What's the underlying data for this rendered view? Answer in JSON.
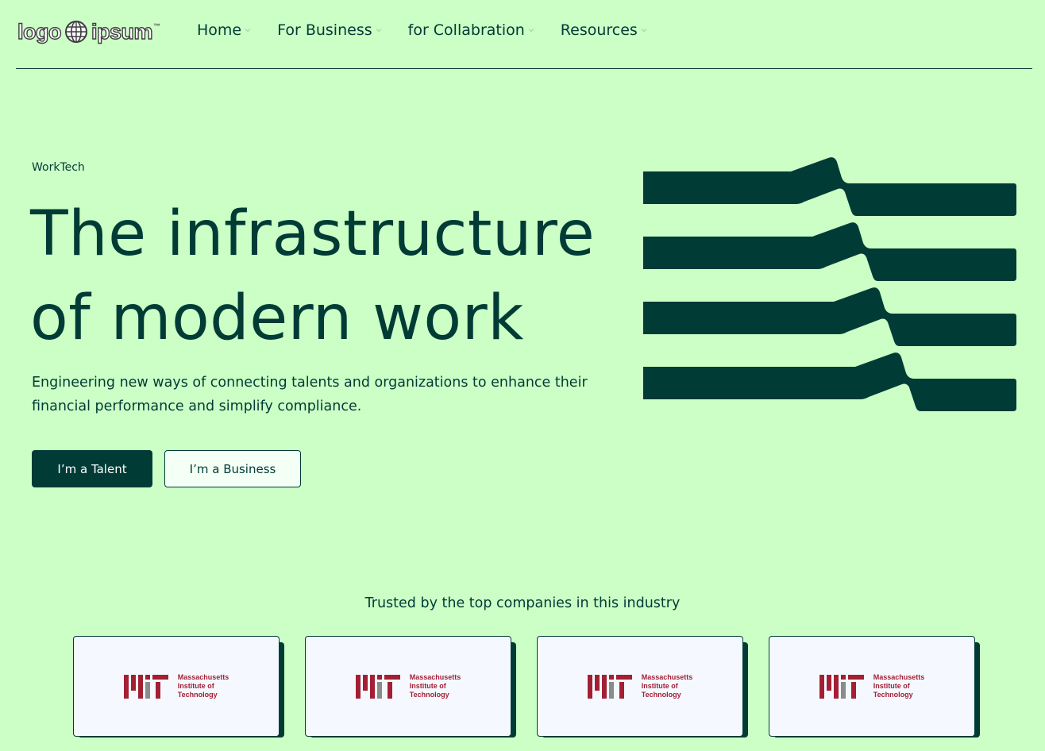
{
  "brand": {
    "logo_left": "logo",
    "logo_right": "ipsum",
    "tm": "™"
  },
  "nav": {
    "items": [
      {
        "label": "Home"
      },
      {
        "label": "For Business"
      },
      {
        "label": "for Collabration"
      },
      {
        "label": "Resources"
      }
    ]
  },
  "hero": {
    "eyebrow": "WorkTech",
    "headline_line1": "The infrastructure",
    "headline_line2": "of modern work",
    "subtext": "Engineering new ways of connecting talents and organizations to enhance their financial performance and simplify compliance.",
    "primary_button": "I’m a Talent",
    "secondary_button": "I’m a Business"
  },
  "trusted": {
    "heading": "Trusted by the top companies in this industry",
    "logos": [
      {
        "line1": "Massachusetts",
        "line2": "Institute of",
        "line3": "Technology"
      },
      {
        "line1": "Massachusetts",
        "line2": "Institute of",
        "line3": "Technology"
      },
      {
        "line1": "Massachusetts",
        "line2": "Institute of",
        "line3": "Technology"
      },
      {
        "line1": "Massachusetts",
        "line2": "Institute of",
        "line3": "Technology"
      }
    ]
  },
  "colors": {
    "background": "#ccffc6",
    "primary": "#003b36",
    "card_bg": "#f5f9ff",
    "mit_red": "#a31f34",
    "mit_gray": "#8a8b8c"
  }
}
